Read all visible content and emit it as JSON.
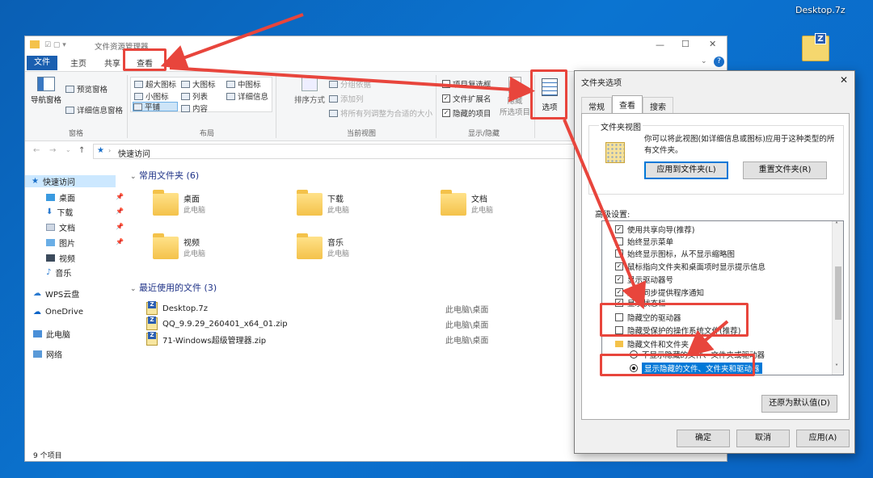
{
  "desktop": {
    "file_label": "Desktop.7z"
  },
  "explorer": {
    "title": "文件资源管理器",
    "tabs": [
      "文件",
      "主页",
      "共享",
      "查看"
    ],
    "ribbon": {
      "pane_group": {
        "nav_pane": "导航窗格",
        "preview_pane": "预览窗格",
        "details_pane": "详细信息窗格",
        "label": "窗格"
      },
      "layout_group": {
        "items": [
          "超大图标",
          "大图标",
          "中图标",
          "小图标",
          "列表",
          "详细信息",
          "平铺",
          "内容"
        ],
        "selected": "平铺",
        "label": "布局"
      },
      "view_group": {
        "sort_by": "排序方式",
        "group_by": "分组依据",
        "add_column": "添加列",
        "fit_columns": "将所有列调整为合适的大小",
        "label": "当前视图"
      },
      "showhide_group": {
        "item_checkboxes": "项目复选框",
        "file_ext": "文件扩展名",
        "hidden_items": "隐藏的项目",
        "hide_selected": "隐藏",
        "hide_selected_2": "所选项目",
        "label": "显示/隐藏"
      },
      "options_label": "选项"
    },
    "address": "快速访问",
    "nav": [
      {
        "label": "快速访问"
      },
      {
        "label": "桌面"
      },
      {
        "label": "下载"
      },
      {
        "label": "文档"
      },
      {
        "label": "图片"
      },
      {
        "label": "视频"
      },
      {
        "label": "音乐"
      },
      {
        "label": "WPS云盘"
      },
      {
        "label": "OneDrive"
      },
      {
        "label": "此电脑"
      },
      {
        "label": "网络"
      }
    ],
    "frequent_header": "常用文件夹 (6)",
    "frequent": [
      {
        "name": "桌面",
        "loc": "此电脑"
      },
      {
        "name": "下载",
        "loc": "此电脑"
      },
      {
        "name": "文档",
        "loc": "此电脑"
      },
      {
        "name": "视频",
        "loc": "此电脑"
      },
      {
        "name": "音乐",
        "loc": "此电脑"
      }
    ],
    "recent_header": "最近使用的文件 (3)",
    "recent": [
      {
        "name": "Desktop.7z",
        "loc": "此电脑\\桌面"
      },
      {
        "name": "QQ_9.9.29_260401_x64_01.zip",
        "loc": "此电脑\\桌面"
      },
      {
        "name": "71-Windows超级管理器.zip",
        "loc": "此电脑\\桌面"
      }
    ],
    "status": "9 个项目"
  },
  "dialog": {
    "title": "文件夹选项",
    "tabs": [
      "常规",
      "查看",
      "搜索"
    ],
    "folder_view_title": "文件夹视图",
    "folder_view_desc": "你可以将此视图(如详细信息或图标)应用于这种类型的所有文件夹。",
    "apply_folders": "应用到文件夹(L)",
    "reset_folders": "重置文件夹(R)",
    "advanced_label": "高级设置:",
    "settings": [
      {
        "label": "使用共享向导(推荐)",
        "checked": "✓"
      },
      {
        "label": "始终显示菜单",
        "checked": ""
      },
      {
        "label": "始终显示图标，从不显示缩略图",
        "checked": ""
      },
      {
        "label": "鼠标指向文件夹和桌面项时显示提示信息",
        "checked": "✓"
      },
      {
        "label": "显示驱动器号",
        "checked": "✓"
      },
      {
        "label": "显示同步提供程序通知",
        "checked": "✓"
      },
      {
        "label": "显示状态栏",
        "checked": "✓"
      },
      {
        "label": "隐藏空的驱动器",
        "checked": ""
      },
      {
        "label": "隐藏受保护的操作系统文件(推荐)",
        "checked": ""
      }
    ],
    "hidden_files_group": "隐藏文件和文件夹",
    "radio_hide": "不显示隐藏的文件、文件夹或驱动器",
    "radio_show": "显示隐藏的文件、文件夹和驱动器",
    "restore_defaults": "还原为默认值(D)",
    "ok": "确定",
    "cancel": "取消",
    "apply": "应用(A)"
  },
  "colors": {
    "annotation_red": "#e8453c",
    "accent_blue": "#0078d7"
  }
}
